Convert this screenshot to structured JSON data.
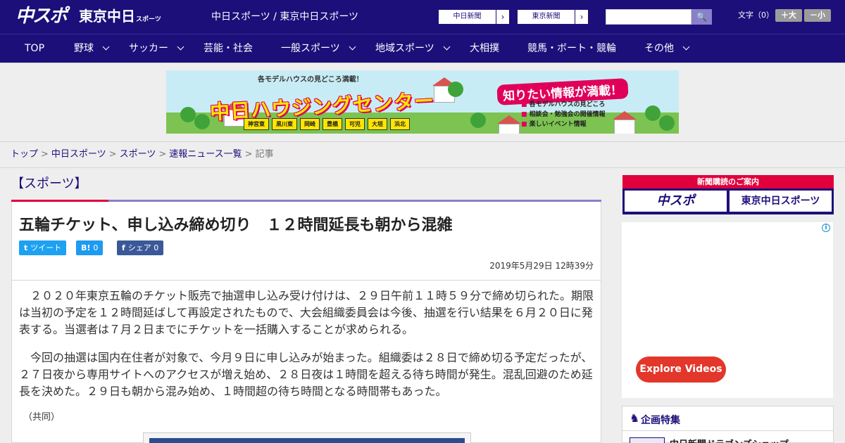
{
  "header": {
    "logo_chuspo": "中スポ",
    "logo_tokyo": "東京中日",
    "logo_tokyo_sub": "スポーツ",
    "site_names": "中日スポーツ / 東京中日スポーツ",
    "paper_links": [
      {
        "label": "中日新聞",
        "arrow": "›"
      },
      {
        "label": "東京新聞",
        "arrow": "›"
      }
    ],
    "search": {
      "placeholder": "",
      "button": "🔍"
    },
    "font_size": {
      "label": "文字（0）",
      "bigger": "＋大",
      "smaller": "－小"
    },
    "colors": {
      "brand": "#1c0f7a",
      "accent": "#e0003c"
    }
  },
  "nav": {
    "items": [
      {
        "label": "TOP",
        "chev": ""
      },
      {
        "label": "野球",
        "chev": "v"
      },
      {
        "label": "サッカー",
        "chev": "v"
      },
      {
        "label": "芸能・社会",
        "chev": ""
      },
      {
        "label": "一般スポーツ",
        "chev": "v"
      },
      {
        "label": "地域スポーツ",
        "chev": "v"
      },
      {
        "label": "大相撲",
        "chev": ""
      },
      {
        "label": "競馬・ボート・競輪",
        "chev": ""
      },
      {
        "label": "その他",
        "chev": "v"
      }
    ]
  },
  "banner": {
    "catch": "各モデルハウスの見どころ満載！",
    "title": "中日ハウジングセンター",
    "right_title": "知りたい情報が満載！",
    "notes": [
      "各モデルハウスの見どころ",
      "相談会・勉強会の開催情報",
      "楽しいイベント情報"
    ],
    "cities": [
      "神宮東",
      "黒川東",
      "岡崎",
      "豊橋",
      "可児",
      "大垣",
      "浜北"
    ]
  },
  "breadcrumb": {
    "items": [
      "トップ",
      "中日スポーツ",
      "スポーツ",
      "速報ニュース一覧"
    ],
    "separator": ">",
    "current": "記事"
  },
  "article": {
    "category": "【スポーツ】",
    "headline": "五輪チケット、申し込み締め切り　１２時間延長も朝から混雑",
    "share": {
      "tweet": {
        "icon": "t",
        "label": "ツイート"
      },
      "hatena": {
        "icon": "B!",
        "count": "0"
      },
      "facebook": {
        "icon": "f",
        "label": "シェア",
        "count": "0"
      }
    },
    "date": "2019年5月29日 12時39分",
    "paragraphs": [
      "　２０２０年東京五輪のチケット販売で抽選申し込み受け付けは、２９日午前１１時５９分で締め切られた。期限は当初の予定を１２時間延ばして再設定されたもので、大会組織委員会は今後、抽選を行い結果を６月２０日に発表する。当選者は７月２日までにチケットを一括購入することが求められる。",
      "　今回の抽選は国内在住者が対象で、今月９日に申し込みが始まった。組織委は２８日で締め切る予定だったが、２７日夜から専用サイトへのアクセスが増え始め、２８日夜は１時間を超える待ち時間が発生。混乱回避のため延長を決めた。２９日も朝から混み始め、１時間超の待ち時間となる時間帯もあった。"
    ],
    "credit": "（共同）"
  },
  "sidebar": {
    "subscribe": {
      "head": "新聞購読のご案内",
      "tiles": [
        "中スポ",
        "東京中日スポーツ"
      ]
    },
    "ad": {
      "info": "i",
      "button": "Explore Videos"
    },
    "feature": {
      "icon": "♞",
      "title": "企画特集",
      "item": "中日新聞ドラゴンズショップ"
    }
  }
}
